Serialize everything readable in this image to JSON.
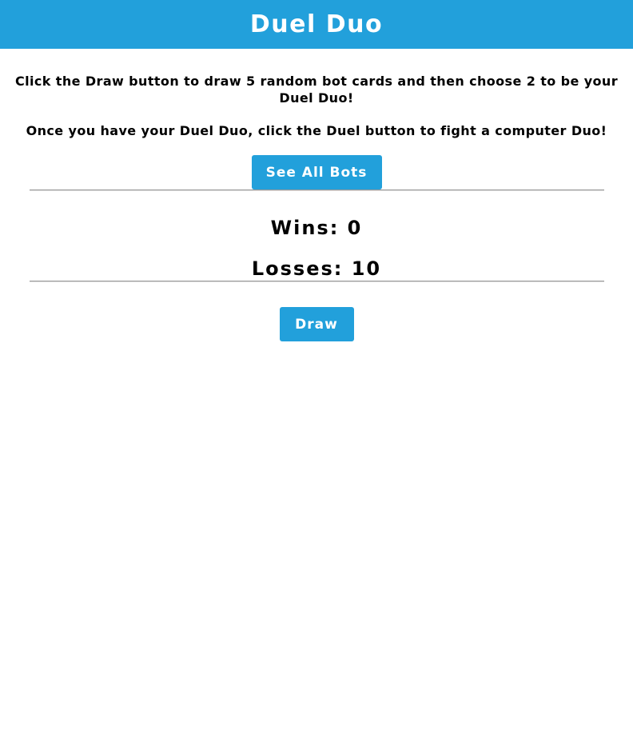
{
  "header": {
    "title": "Duel Duo"
  },
  "instructions": {
    "line1": "Click the Draw button to draw 5 random bot cards and then choose 2 to be your Duel Duo!",
    "line2": "Once you have your Duel Duo, click the Duel button to fight a computer Duo!"
  },
  "buttons": {
    "see_all_bots": "See All Bots",
    "draw": "Draw"
  },
  "stats": {
    "wins_label": "Wins: ",
    "wins": "0",
    "losses_label": "Losses: ",
    "losses": "10"
  },
  "colors": {
    "accent": "#22a0db",
    "button_text": "#ffffff"
  }
}
